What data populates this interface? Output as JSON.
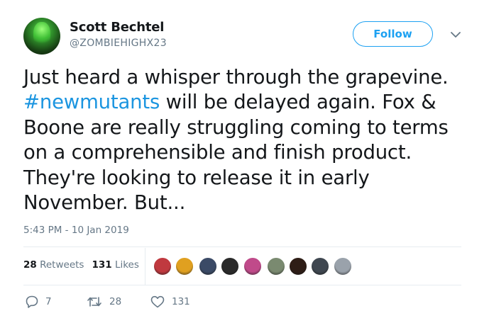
{
  "author": {
    "name": "Scott Bechtel",
    "handle": "@ZOMBIEHIGHX23"
  },
  "follow_label": "Follow",
  "tweet": {
    "text_part1": "Just heard a whisper through the grapevine.",
    "hashtag": "#newmutants",
    "text_part2": " will be delayed again. Fox & Boone are really struggling coming to terms on a comprehensible and finish product. They're looking to release it in early November. But..."
  },
  "timestamp": "5:43 PM - 10 Jan 2019",
  "stats": {
    "retweets_count": "28",
    "retweets_label": "Retweets",
    "likes_count": "131",
    "likes_label": "Likes"
  },
  "likers": [
    {
      "name": "liker-1",
      "color": "#c0393f"
    },
    {
      "name": "liker-2",
      "color": "#e0a020"
    },
    {
      "name": "liker-3",
      "color": "#3b4a66"
    },
    {
      "name": "liker-4",
      "color": "#2a2a2a"
    },
    {
      "name": "liker-5",
      "color": "#c04a8a"
    },
    {
      "name": "liker-6",
      "color": "#7a8a70"
    },
    {
      "name": "liker-7",
      "color": "#2e1d16"
    },
    {
      "name": "liker-8",
      "color": "#3f4750"
    },
    {
      "name": "liker-9",
      "color": "#9aa2ab"
    }
  ],
  "actions": {
    "replies": "7",
    "retweets": "28",
    "likes": "131"
  },
  "colors": {
    "accent": "#1da1f2",
    "hashtag": "#1b95e0",
    "secondary_text": "#657786",
    "divider": "#e6ecf0"
  },
  "icons": [
    "reply-icon",
    "retweet-icon",
    "like-icon",
    "chevron-down-icon"
  ]
}
